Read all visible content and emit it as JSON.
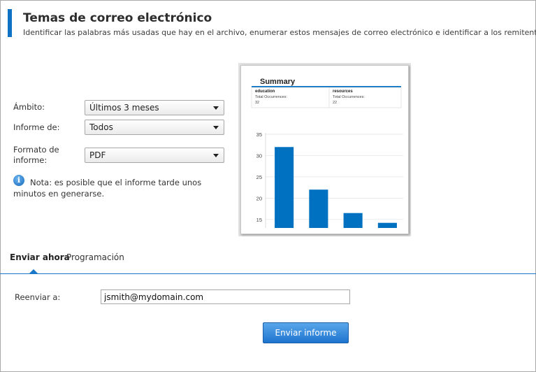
{
  "header": {
    "title": "Temas de correo electrónico",
    "subtitle": "Identificar las palabras más usadas que hay en el archivo, enumerar estos mensajes de correo electrónico e identificar a los remitentes."
  },
  "form": {
    "scope": {
      "label": "Ámbito:",
      "value": "Últimos 3 meses"
    },
    "report_of": {
      "label": "Informe de:",
      "value": "Todos"
    },
    "format": {
      "label": "Formato de informe:",
      "value": "PDF"
    }
  },
  "note": {
    "icon": "info-icon",
    "text": "Nota: es posible que el informe tarde unos minutos en generarse."
  },
  "preview": {
    "title": "Summary",
    "cards": [
      {
        "term": "education",
        "label": "Total Occurrences:",
        "count": "32"
      },
      {
        "term": "resources",
        "label": "Total Occurrences:",
        "count": "22"
      }
    ]
  },
  "chart_data": {
    "type": "bar",
    "categories": [
      "",
      "",
      "",
      ""
    ],
    "values": [
      32,
      22,
      16.5,
      14.2
    ],
    "title": "",
    "xlabel": "",
    "ylabel": "",
    "ylim": [
      13,
      35
    ],
    "yticks": [
      15,
      20,
      25,
      30,
      35
    ],
    "grid": true,
    "bar_color": "#0070c0"
  },
  "tabs": [
    {
      "label": "Enviar ahora",
      "active": true
    },
    {
      "label": "Programación",
      "active": false
    }
  ],
  "send": {
    "forward_label": "Reenviar a:",
    "forward_value": "jsmith@mydomain.com",
    "button_label": "Enviar informe"
  },
  "colors": {
    "accent": "#0f72c4",
    "button": "#1d74cf"
  }
}
